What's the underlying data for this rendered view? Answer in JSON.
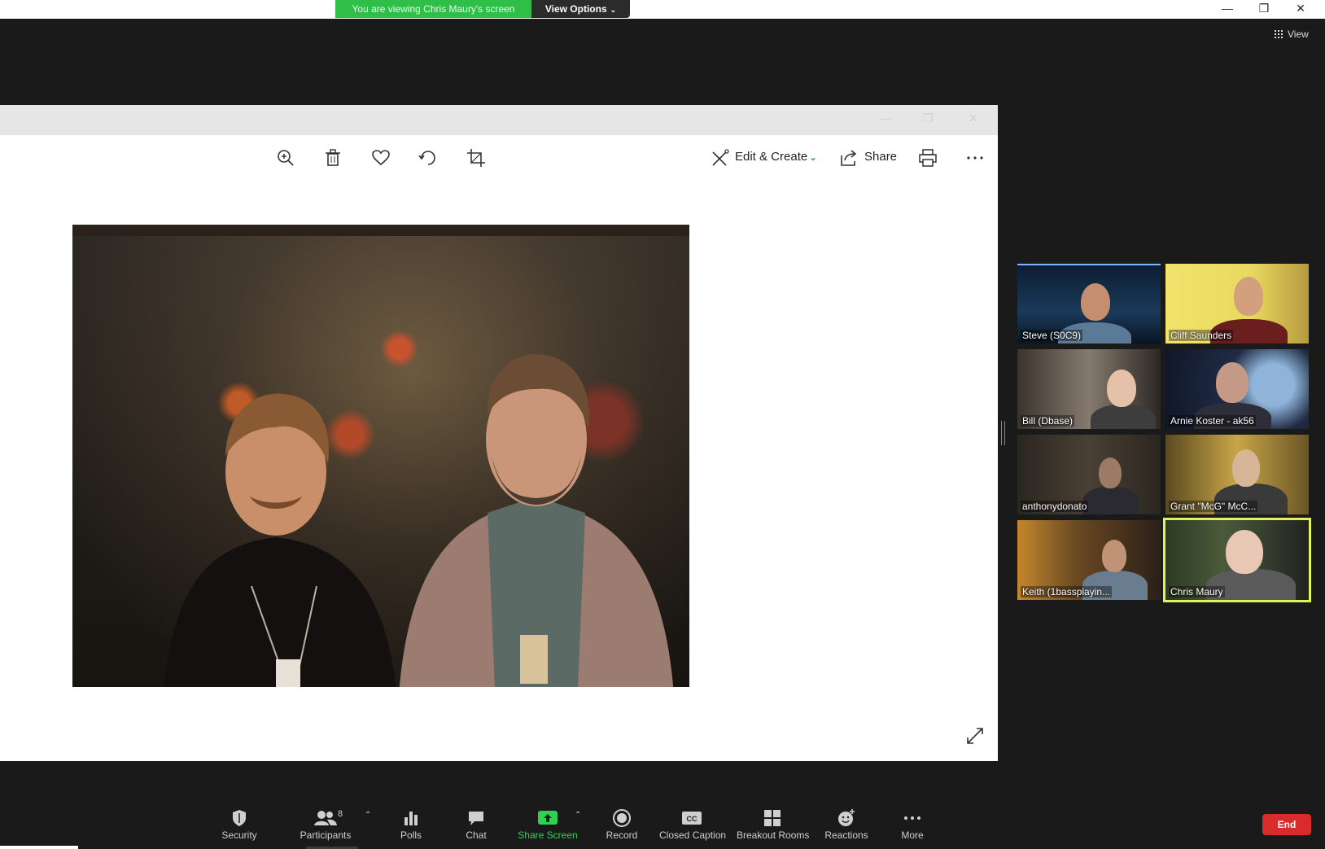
{
  "meeting": {
    "banner": "You are viewing Chris Maury's screen",
    "view_options": "View Options",
    "view_button": "View",
    "participant_count": "8",
    "end": "End"
  },
  "photos_app": {
    "edit_create": "Edit & Create",
    "share": "Share",
    "toolbar_icons": [
      "zoom-in-icon",
      "delete-icon",
      "heart-icon",
      "rotate-icon",
      "crop-icon",
      "print-icon",
      "more-icon"
    ]
  },
  "gallery": [
    {
      "name": "Steve (S0C9)"
    },
    {
      "name": "Cliff Saunders"
    },
    {
      "name": "Bill (Dbase)"
    },
    {
      "name": "Arnie Koster - ak56"
    },
    {
      "name": "anthonydonato"
    },
    {
      "name": "Grant \"McG\" McC..."
    },
    {
      "name": "Keith (1bassplayin..."
    },
    {
      "name": "Chris Maury"
    }
  ],
  "controls": {
    "security": "Security",
    "participants": "Participants",
    "polls": "Polls",
    "chat": "Chat",
    "share_screen": "Share Screen",
    "record": "Record",
    "closed_caption": "Closed Caption",
    "breakout_rooms": "Breakout Rooms",
    "reactions": "Reactions",
    "more": "More"
  },
  "colors": {
    "banner_green": "#2fbf49",
    "share_green": "#2fd153",
    "end_red": "#d92b2b",
    "active_speaker": "#e2f25b"
  }
}
